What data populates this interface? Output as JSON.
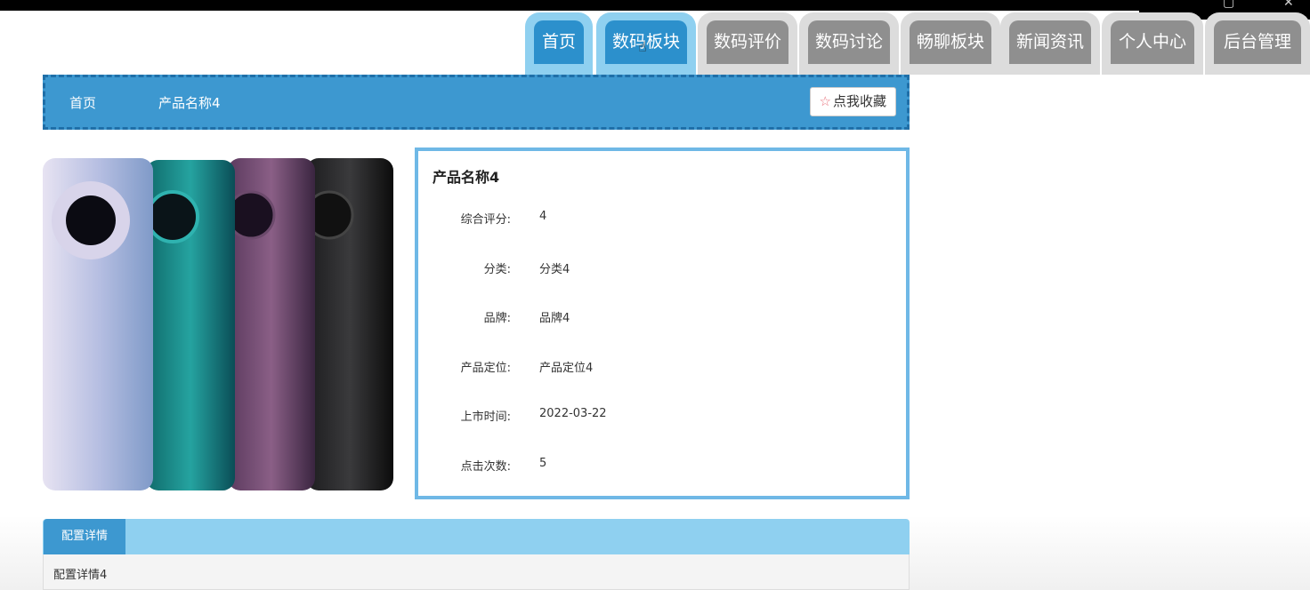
{
  "nav": {
    "tabs": [
      {
        "label": "首页"
      },
      {
        "label": "数码板块"
      },
      {
        "label": "数码评价"
      },
      {
        "label": "数码讨论"
      },
      {
        "label": "畅聊板块"
      },
      {
        "label": "新闻资讯"
      },
      {
        "label": "个人中心"
      },
      {
        "label": "后台管理"
      }
    ]
  },
  "breadcrumb": {
    "home": "首页",
    "current": "产品名称4"
  },
  "favorite": {
    "icon": "star-outline-icon",
    "label": "点我收藏"
  },
  "product": {
    "name": "产品名称4",
    "fields": [
      {
        "label": "综合评分:",
        "value": "4"
      },
      {
        "label": "分类:",
        "value": "分类4"
      },
      {
        "label": "品牌:",
        "value": "品牌4"
      },
      {
        "label": "产品定位:",
        "value": "产品定位4"
      },
      {
        "label": "上市时间:",
        "value": "2022-03-22"
      },
      {
        "label": "点击次数:",
        "value": "5"
      }
    ]
  },
  "detail": {
    "tab_label": "配置详情",
    "content": "配置详情4"
  },
  "colors": {
    "accent": "#3d98d0",
    "tab_active_ring": "#8fd0f0",
    "tab_inactive": "#8f8f8f",
    "border": "#6fb8e6"
  }
}
